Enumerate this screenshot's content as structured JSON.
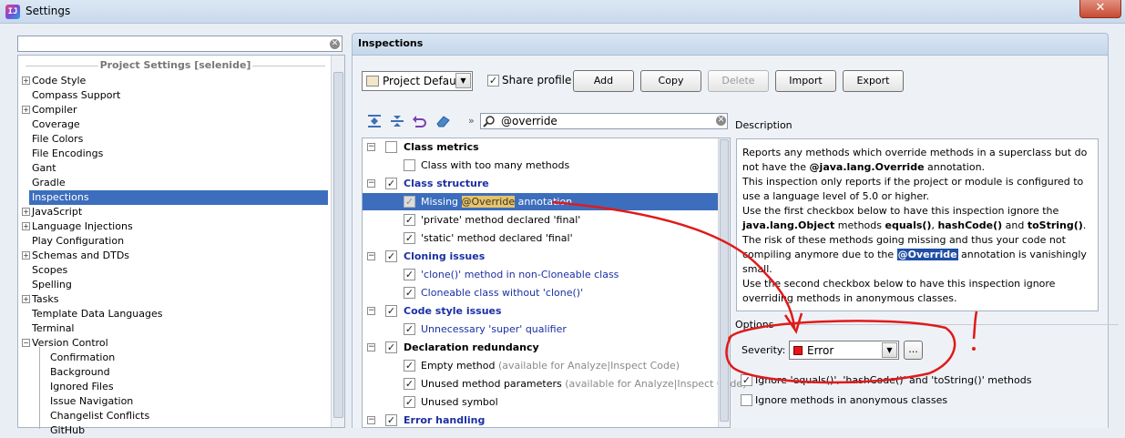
{
  "window": {
    "title": "Settings",
    "logo_text": "IJ",
    "close_glyph": "✕"
  },
  "left": {
    "search_value": "",
    "clear_glyph": "✕",
    "header": "Project Settings [selenide]",
    "items": [
      {
        "label": "Code Style",
        "expandable": true
      },
      {
        "label": "Compass Support",
        "expandable": false
      },
      {
        "label": "Compiler",
        "expandable": true
      },
      {
        "label": "Coverage",
        "expandable": false
      },
      {
        "label": "File Colors",
        "expandable": false
      },
      {
        "label": "File Encodings",
        "expandable": false
      },
      {
        "label": "Gant",
        "expandable": false
      },
      {
        "label": "Gradle",
        "expandable": false
      },
      {
        "label": "Inspections",
        "expandable": false,
        "selected": true
      },
      {
        "label": "JavaScript",
        "expandable": true
      },
      {
        "label": "Language Injections",
        "expandable": true
      },
      {
        "label": "Play Configuration",
        "expandable": false
      },
      {
        "label": "Schemas and DTDs",
        "expandable": true
      },
      {
        "label": "Scopes",
        "expandable": false
      },
      {
        "label": "Spelling",
        "expandable": false
      },
      {
        "label": "Tasks",
        "expandable": true
      },
      {
        "label": "Template Data Languages",
        "expandable": false
      },
      {
        "label": "Terminal",
        "expandable": false
      },
      {
        "label": "Version Control",
        "expandable": true,
        "expanded": true
      }
    ],
    "vcs_children": [
      "Confirmation",
      "Background",
      "Ignored Files",
      "Issue Navigation",
      "Changelist Conflicts",
      "GitHub"
    ]
  },
  "inspections": {
    "title": "Inspections",
    "profile": "Project Default",
    "share_profile": "Share profile",
    "share_profile_checked": true,
    "buttons": {
      "add": "Add",
      "copy": "Copy",
      "delete": "Delete",
      "import": "Import",
      "export": "Export"
    },
    "toolbar": {
      "separator": "»"
    },
    "search_value": "@override",
    "tree": {
      "class_metrics": {
        "label": "Class metrics",
        "checked": false
      },
      "class_too_many": {
        "label": "Class with too many methods",
        "checked": false
      },
      "class_structure": {
        "label": "Class structure",
        "checked": true
      },
      "missing_override": {
        "prefix": "Missing ",
        "highlight": "@Override",
        "suffix": " annotation",
        "checked": true
      },
      "private_final": {
        "label": "'private' method declared 'final'",
        "checked": true
      },
      "static_final": {
        "label": "'static' method declared 'final'",
        "checked": true
      },
      "cloning": {
        "label": "Cloning issues",
        "checked": true
      },
      "clone_noncloneable": {
        "label": "'clone()' method in non-Cloneable class",
        "checked": true
      },
      "cloneable_without": {
        "label": "Cloneable class without 'clone()'",
        "checked": true
      },
      "code_style": {
        "label": "Code style issues",
        "checked": true
      },
      "unnecessary_super": {
        "label": "Unnecessary 'super' qualifier",
        "checked": true
      },
      "decl_redundancy": {
        "label": "Declaration redundancy",
        "checked": true
      },
      "empty_method": {
        "label": "Empty method",
        "note": "(available for Analyze|Inspect Code)",
        "checked": true
      },
      "unused_params": {
        "label": "Unused method parameters",
        "note": "(available for Analyze|Inspect Code)",
        "checked": true
      },
      "unused_symbol": {
        "label": "Unused symbol",
        "checked": true
      },
      "error_handling": {
        "label": "Error handling",
        "checked": true
      }
    },
    "description": {
      "label": "Description",
      "p1a": "Reports any methods which override methods in a superclass but do not have the ",
      "p1b": "@java.lang.Override",
      "p1c": " annotation.",
      "p2": "This inspection only reports if the project or module is configured to use a language level of 5.0 or higher.",
      "p3a": "Use the first checkbox below to have this inspection ignore the ",
      "p3b": "java.lang.Object",
      "p3c": " methods ",
      "p3d": "equals()",
      "p3e": ", ",
      "p3f": "hashCode()",
      "p3g": " and ",
      "p3h": "toString()",
      "p3i": ". The risk of these methods going missing and thus your code not compiling anymore due to the ",
      "p3j": "@Override",
      "p3k": " annotation is vanishingly small.",
      "p4": "Use the second checkbox below to have this inspection ignore overriding methods in anonymous classes."
    },
    "options": {
      "label": "Options",
      "severity_label": "Severity:",
      "severity_value": "Error",
      "severity_color": "#e8141b",
      "dots": "...",
      "ignore_object_methods": "Ignore 'equals()', 'hashCode()' and 'toString()' methods",
      "ignore_object_methods_checked": true,
      "ignore_anonymous": "Ignore methods in anonymous classes",
      "ignore_anonymous_checked": false
    }
  },
  "annotation": {
    "color": "#e01a1a",
    "exclamation": "!"
  }
}
